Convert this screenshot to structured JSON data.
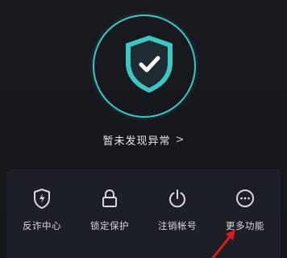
{
  "status": {
    "text": "暂未发现异常"
  },
  "tools": [
    {
      "label": "反诈中心",
      "icon": "lightning-shield-icon"
    },
    {
      "label": "锁定保护",
      "icon": "lock-icon"
    },
    {
      "label": "注销帐号",
      "icon": "power-icon"
    },
    {
      "label": "更多功能",
      "icon": "more-dots-icon"
    }
  ],
  "colors": {
    "accent": "#3ec6c5",
    "background": "#16171d",
    "panel": "#1d1f27",
    "text": "#e6e7eb",
    "annotation_arrow": "#e01a1a"
  }
}
